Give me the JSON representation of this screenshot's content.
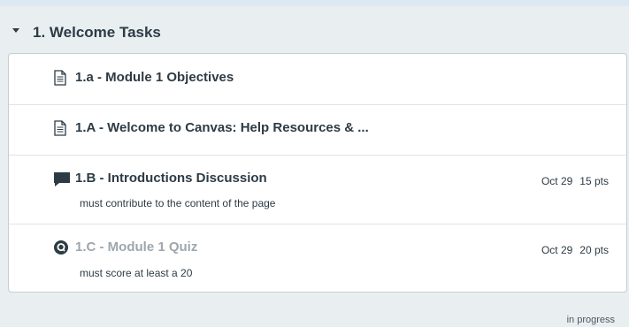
{
  "module": {
    "title": "1. Welcome Tasks",
    "status": "in progress"
  },
  "items": [
    {
      "icon": "page-icon",
      "title": "1.a - Module 1 Objectives",
      "subtitle": "",
      "date": "",
      "points": ""
    },
    {
      "icon": "page-icon",
      "title": "1.A - Welcome to Canvas: Help Resources & ...",
      "subtitle": "",
      "date": "",
      "points": ""
    },
    {
      "icon": "discussion-icon",
      "title": "1.B - Introductions Discussion",
      "subtitle": "must contribute to the content of the page",
      "date": "Oct 29",
      "points": "15 pts"
    },
    {
      "icon": "quiz-icon",
      "title": "1.C - Module 1 Quiz",
      "subtitle": "must score at least a 20",
      "date": "Oct 29",
      "points": "20 pts"
    }
  ]
}
